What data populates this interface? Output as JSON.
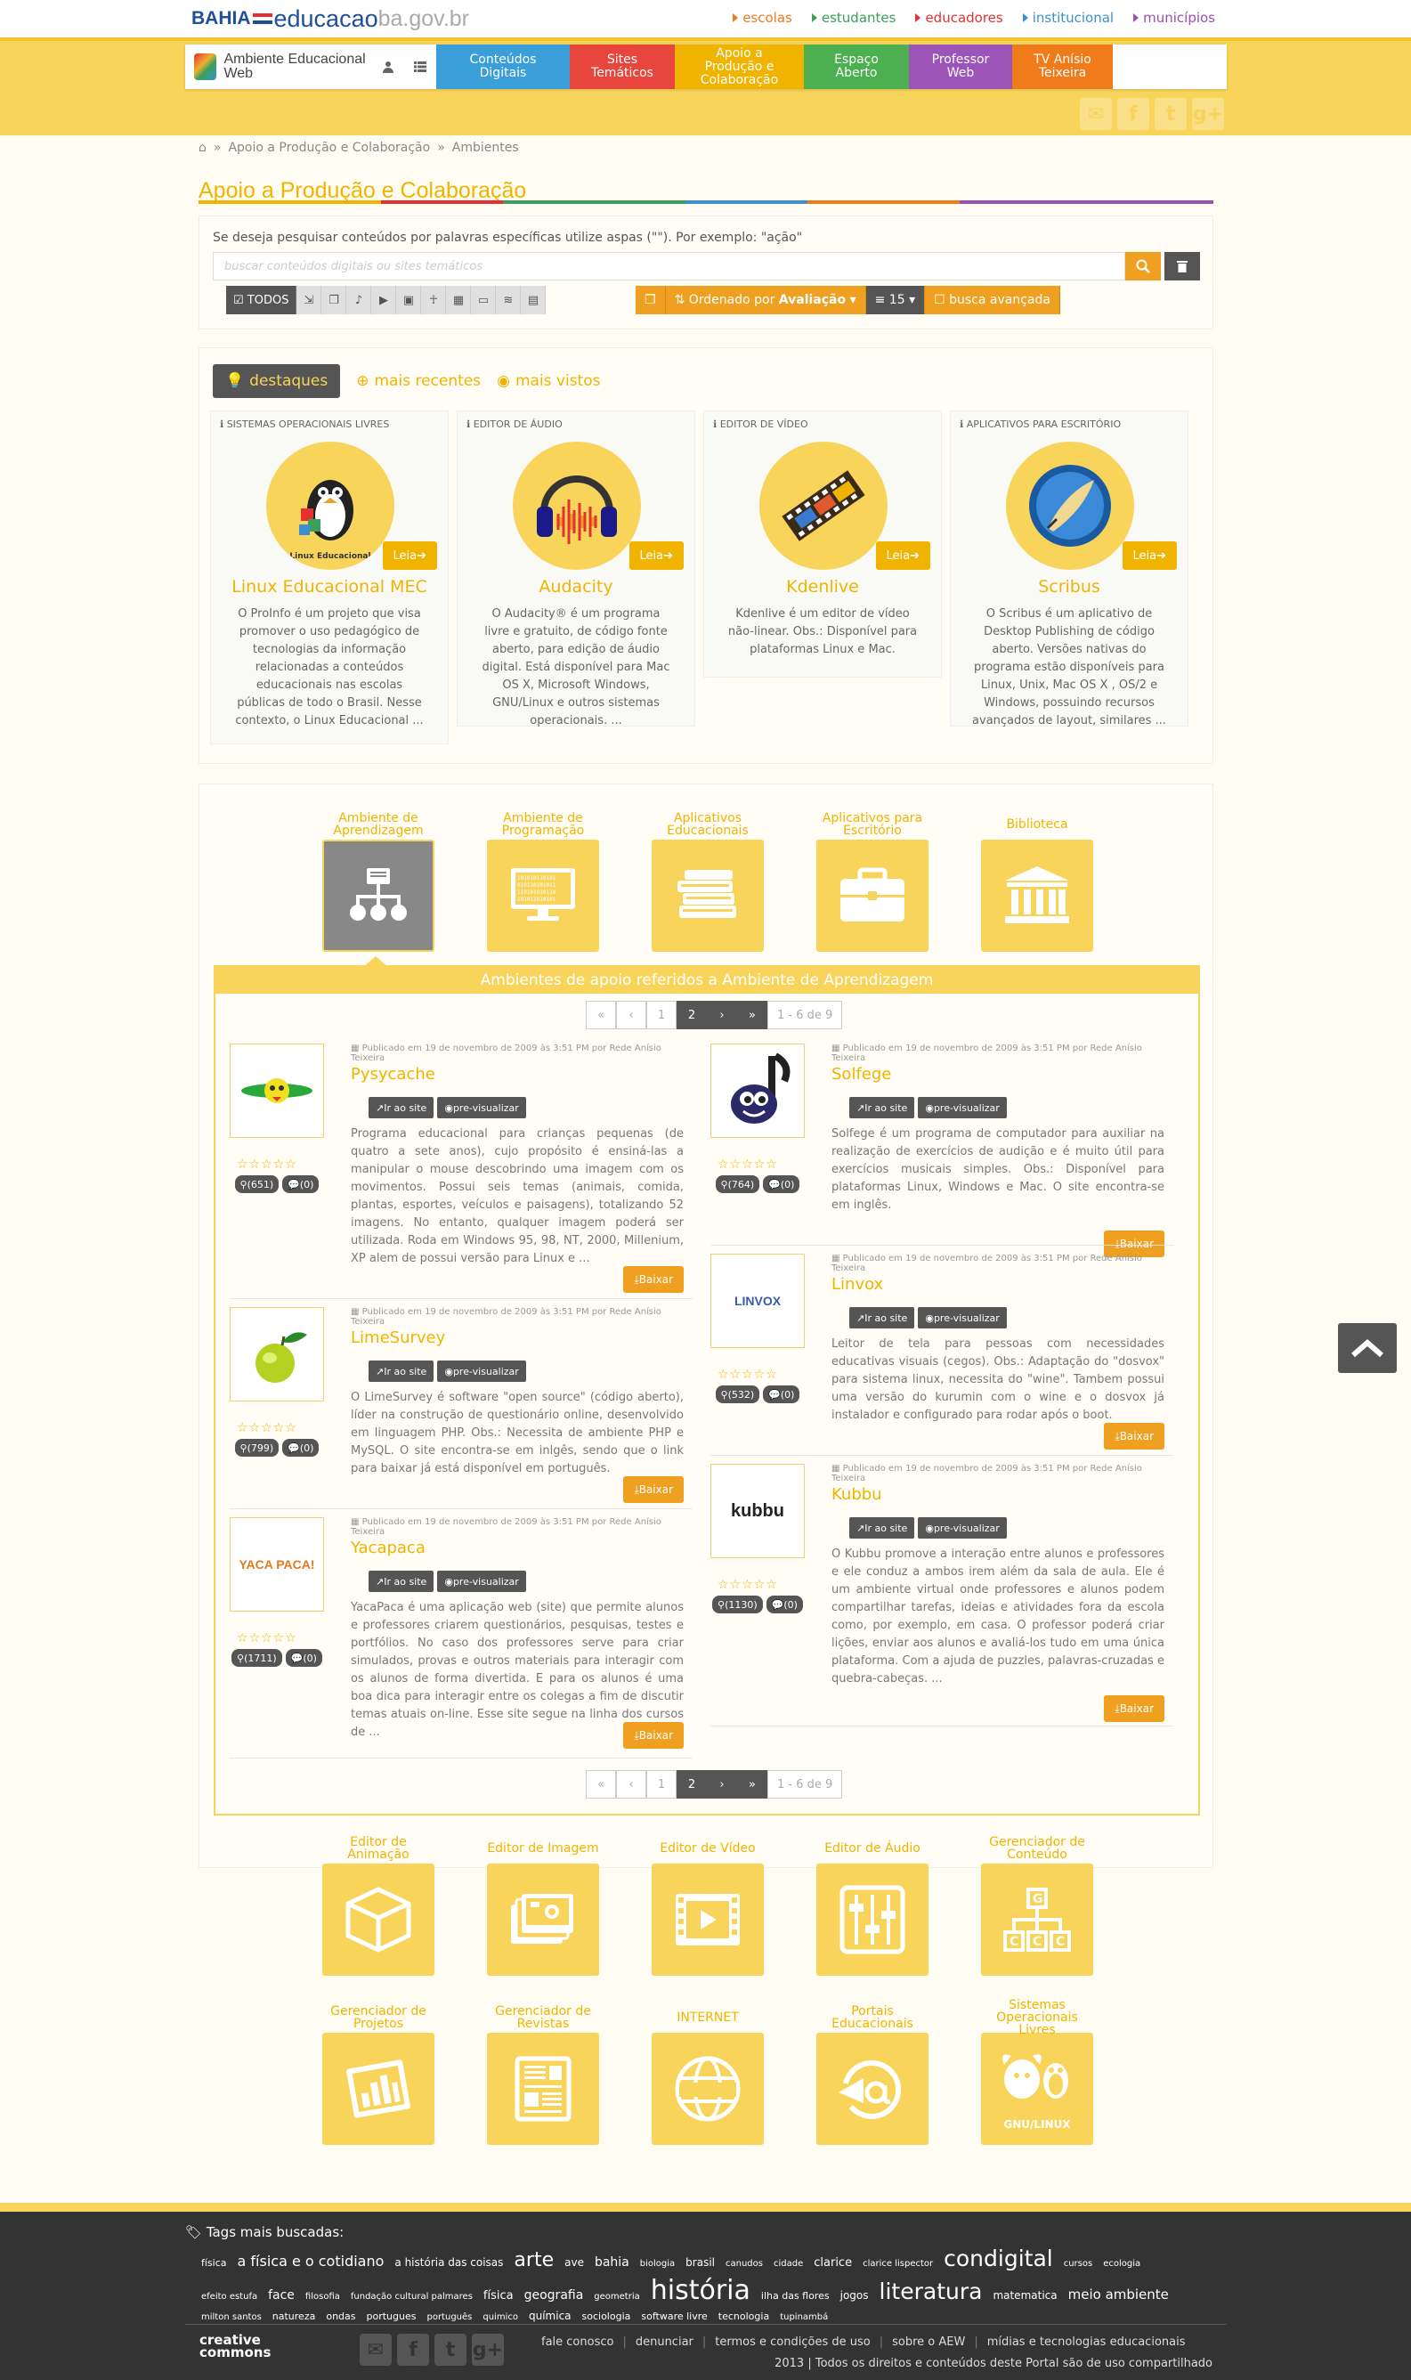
{
  "site": {
    "logo_bahia": "BAHIA",
    "logo_edu": "educacao",
    "logo_gov": "ba.gov.br",
    "top_links": [
      {
        "label": "escolas",
        "color": "#f07b1a"
      },
      {
        "label": "estudantes",
        "color": "#3aa05a"
      },
      {
        "label": "educadores",
        "color": "#e53030"
      },
      {
        "label": "institucional",
        "color": "#3a90d0"
      },
      {
        "label": "municípios",
        "color": "#9a50b0"
      }
    ]
  },
  "nav": {
    "brand": "Ambiente Educacional Web",
    "tabs": [
      {
        "label": "Conteúdos Digitais",
        "color": "#3a9fd8"
      },
      {
        "label": "Sites Temáticos",
        "color": "#e8453c"
      },
      {
        "label": "Apoio a Produção e Colaboração",
        "color": "#f0b400"
      },
      {
        "label": "Espaço Aberto",
        "color": "#4cb050"
      },
      {
        "label": "Professor Web",
        "color": "#9b55b8"
      },
      {
        "label": "TV Anísio Teixeira",
        "color": "#f07b1a"
      }
    ]
  },
  "breadcrumb": [
    "Apoio a Produção e Colaboração",
    "Ambientes"
  ],
  "page_title": "Apoio a Produção e Colaboração",
  "search": {
    "hint": "Se deseja pesquisar conteúdos por palavras específicas utilize aspas (\"\"). Por exemplo: \"ação\"",
    "placeholder": "buscar conteúdos digitais ou sites temáticos",
    "all_label": "TODOS",
    "sort_label": "Ordenado por",
    "sort_value": "Avaliação",
    "per_page": "15",
    "advanced": "busca avançada"
  },
  "highlight_tabs": [
    "destaques",
    "mais recentes",
    "mais vistos"
  ],
  "highlights": [
    {
      "category": "SISTEMAS OPERACIONAIS LIVRES",
      "title": "Linux Educacional MEC",
      "desc": "O ProInfo é um projeto que visa promover o uso pedagógico de tecnologias da informação relacionadas a conteúdos educacionais nas escolas públicas de todo o Brasil. Nesse contexto, o Linux Educacional ...",
      "thumb_text": "Linux Educacional"
    },
    {
      "category": "EDITOR DE ÁUDIO",
      "title": "Audacity",
      "desc": "O Audacity® é um programa livre e gratuito, de código fonte aberto, para edição de áudio digital. Está disponível para Mac OS X, Microsoft Windows, GNU/Linux e outros sistemas operacionais. ..."
    },
    {
      "category": "EDITOR DE VÍDEO",
      "title": "Kdenlive",
      "desc": "Kdenlive é um editor de vídeo não-linear. Obs.: Disponível para plataformas Linux e Mac."
    },
    {
      "category": "APLICATIVOS PARA ESCRITÓRIO",
      "title": "Scribus",
      "desc": "O Scribus é um aplicativo de Desktop Publishing de código aberto. Versões nativas do programa estão disponíveis para Linux, Unix, Mac OS X , OS/2 e Windows, possuindo recursos avançados de layout, similares ..."
    }
  ],
  "read_label": "Leia",
  "env_categories_top": [
    "Ambiente de Aprendizagem",
    "Ambiente de Programação",
    "Aplicativos Educacionais",
    "Aplicativos para Escritório",
    "Biblioteca"
  ],
  "results_title": "Ambientes de apoio referidos a Ambiente de Aprendizagem",
  "pager": {
    "first": "«",
    "prev": "‹",
    "pages": [
      "1",
      "2"
    ],
    "next": "›",
    "last": "»",
    "info": "1 - 6 de 9"
  },
  "item_labels": {
    "visit": "Ir ao site",
    "preview": "pre-visualizar",
    "download": "Baixar",
    "stars": "☆☆☆☆☆"
  },
  "items": [
    {
      "title": "Pysycache",
      "meta": "Publicado em 19 de novembro de 2009 às 3:51 PM por Rede Anísio Teixeira",
      "views": "(651)",
      "comments": "(0)",
      "desc": "Programa educacional para crianças pequenas (de quatro a sete anos), cujo propósito é ensiná-las a manipular o mouse descobrindo uma imagem com os movimentos. Possui seis temas (animais, comida, plantas, esportes, veículos e paisagens), totalizando 52 imagens. No entanto, qualquer imagem poderá ser utilizada. Roda em Windows 95, 98, NT, 2000, Millenium, XP alem de possui versão para Linux e ..."
    },
    {
      "title": "Solfege",
      "meta": "Publicado em 19 de novembro de 2009 às 3:51 PM por Rede Anísio Teixeira",
      "views": "(764)",
      "comments": "(0)",
      "desc": "Solfege é um programa de computador para auxiliar na realização de exercícios de audição e é muito útil para exercícios musicais simples. Obs.: Disponível para plataformas Linux, Windows e Mac. O site encontra-se em inglês."
    },
    {
      "title": "LimeSurvey",
      "meta": "Publicado em 19 de novembro de 2009 às 3:51 PM por Rede Anísio Teixeira",
      "views": "(799)",
      "comments": "(0)",
      "desc": "O LimeSurvey é software \"open source\" (código aberto), líder na construção de questionário online, desenvolvido em linguagem PHP. Obs.: Necessita de ambiente PHP e MySQL. O site encontra-se em inlgês, sendo que o link para baixar já está disponível em português."
    },
    {
      "title": "Linvox",
      "meta": "Publicado em 19 de novembro de 2009 às 3:51 PM por Rede Anísio Teixeira",
      "views": "(532)",
      "comments": "(0)",
      "desc": "Leitor de tela para pessoas com necessidades educativas visuais (cegos). Obs.: Adaptação do \"dosvox\" para sistema linux, necessita do \"wine\". Tambem possui uma versão do kurumin com o wine e o dosvox já instalador e configurado para rodar após o boot.",
      "thumb_text": "LINVOX"
    },
    {
      "title": "Yacapaca",
      "meta": "Publicado em 19 de novembro de 2009 às 3:51 PM por Rede Anísio Teixeira",
      "views": "(1711)",
      "comments": "(0)",
      "desc": "YacaPaca é uma aplicação web (site) que permite alunos e professores criarem questionários, pesquisas, testes e portfólios. No caso dos professores serve para criar simulados, provas e outros materiais para interagir com os alunos de forma divertida. E para os alunos é uma boa dica para interagir entre os colegas a fim de discutir temas atuais on-line. Esse site segue na linha dos cursos de ...",
      "thumb_text": "YACA PACA!"
    },
    {
      "title": "Kubbu",
      "meta": "Publicado em 19 de novembro de 2009 às 3:51 PM por Rede Anísio Teixeira",
      "views": "(1130)",
      "comments": "(0)",
      "desc": "O Kubbu promove a interação entre alunos e professores e ele conduz a ambos irem além da sala de aula. Ele é um ambiente virtual onde professores e alunos podem compartilhar tarefas, ideias e atividades fora da escola como, por exemplo, em casa. O professor poderá criar lições, enviar aos alunos e avaliá-los tudo em uma única plataforma. Com a ajuda de puzzles, palavras-cruzadas e quebra-cabeças. ...",
      "thumb_text": "kubbu"
    }
  ],
  "env_categories_bottom": [
    "Editor de Animação",
    "Editor de Imagem",
    "Editor de Vídeo",
    "Editor de Áudio",
    "Gerenciador de Conteúdo",
    "Gerenciador de Projetos",
    "Gerenciador de Revistas",
    "INTERNET",
    "Portais Educacionais",
    "Sistemas Operacionais Livres"
  ],
  "env_icon_text": {
    "gnu": "GNU/LINUX",
    "www": "WWW",
    "gcc": "G C C C"
  },
  "footer": {
    "tags_title": "Tags mais buscadas:",
    "tags": [
      {
        "t": "física",
        "s": 11
      },
      {
        "t": "a física e o cotidiano",
        "s": 16
      },
      {
        "t": "a história das coisas",
        "s": 12
      },
      {
        "t": "arte",
        "s": 22
      },
      {
        "t": "ave",
        "s": 12
      },
      {
        "t": "bahia",
        "s": 14
      },
      {
        "t": "biologia",
        "s": 10
      },
      {
        "t": "brasil",
        "s": 12
      },
      {
        "t": "canudos",
        "s": 10
      },
      {
        "t": "cidade",
        "s": 10
      },
      {
        "t": "clarice",
        "s": 13
      },
      {
        "t": "clarice lispector",
        "s": 10
      },
      {
        "t": "condigital",
        "s": 25
      },
      {
        "t": "cursos",
        "s": 10
      },
      {
        "t": "ecologia",
        "s": 10
      },
      {
        "t": "efeito estufa",
        "s": 10
      },
      {
        "t": "face",
        "s": 14
      },
      {
        "t": "filosofia",
        "s": 10
      },
      {
        "t": "fundação cultural palmares",
        "s": 10
      },
      {
        "t": "física",
        "s": 13
      },
      {
        "t": "geografia",
        "s": 14
      },
      {
        "t": "geometria",
        "s": 10
      },
      {
        "t": "história",
        "s": 30
      },
      {
        "t": "ilha das flores",
        "s": 11
      },
      {
        "t": "jogos",
        "s": 12
      },
      {
        "t": "literatura",
        "s": 25
      },
      {
        "t": "matematica",
        "s": 12
      },
      {
        "t": "meio ambiente",
        "s": 15
      },
      {
        "t": "milton santos",
        "s": 10
      },
      {
        "t": "natureza",
        "s": 11
      },
      {
        "t": "ondas",
        "s": 11
      },
      {
        "t": "portugues",
        "s": 11
      },
      {
        "t": "português",
        "s": 10
      },
      {
        "t": "quimico",
        "s": 10
      },
      {
        "t": "química",
        "s": 12
      },
      {
        "t": "sociologia",
        "s": 11
      },
      {
        "t": "software livre",
        "s": 11
      },
      {
        "t": "tecnologia",
        "s": 11
      },
      {
        "t": "tupinambá",
        "s": 10
      }
    ],
    "cc": "creative commons",
    "links": [
      "fale conosco",
      "denunciar",
      "termos e condições de uso",
      "sobre o AEW",
      "mídias e tecnologias educacionais"
    ],
    "copyright": "2013 | Todos os direitos e conteúdos deste Portal são de uso compartilhado"
  }
}
